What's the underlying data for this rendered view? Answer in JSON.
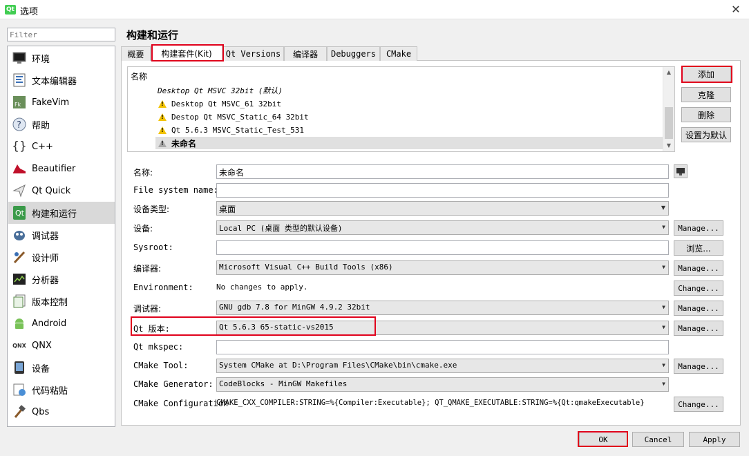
{
  "window": {
    "title": "选项",
    "app_icon_text": "Qt",
    "close_glyph": "✕"
  },
  "sidebar": {
    "filter_placeholder": "Filter",
    "items": [
      {
        "label": "环境",
        "icon": "monitor-icon"
      },
      {
        "label": "文本编辑器",
        "icon": "text-editor-icon"
      },
      {
        "label": "FakeVim",
        "icon": "fakevim-icon"
      },
      {
        "label": "帮助",
        "icon": "help-icon"
      },
      {
        "label": "C++",
        "icon": "cpp-icon"
      },
      {
        "label": "Beautifier",
        "icon": "beautifier-icon"
      },
      {
        "label": "Qt Quick",
        "icon": "qt-quick-icon"
      },
      {
        "label": "构建和运行",
        "icon": "build-run-icon"
      },
      {
        "label": "调试器",
        "icon": "debugger-icon"
      },
      {
        "label": "设计师",
        "icon": "designer-icon"
      },
      {
        "label": "分析器",
        "icon": "analyzer-icon"
      },
      {
        "label": "版本控制",
        "icon": "version-control-icon"
      },
      {
        "label": "Android",
        "icon": "android-icon"
      },
      {
        "label": "QNX",
        "icon": "qnx-icon"
      },
      {
        "label": "设备",
        "icon": "device-icon"
      },
      {
        "label": "代码粘贴",
        "icon": "code-paste-icon"
      },
      {
        "label": "Qbs",
        "icon": "qbs-icon"
      }
    ]
  },
  "main": {
    "title": "构建和运行",
    "tabs": [
      "概要",
      "构建套件(Kit)",
      "Qt Versions",
      "编译器",
      "Debuggers",
      "CMake"
    ],
    "kit_list": {
      "header": "名称",
      "group": "Desktop Qt MSVC 32bit (默认)",
      "rows": [
        "Desktop Qt MSVC_61 32bit",
        "Destop Qt MSVC_Static_64 32bit",
        "Qt 5.6.3 MSVC_Static_Test_531",
        "未命名"
      ]
    },
    "side_buttons": {
      "add": "添加",
      "clone": "克隆",
      "delete": "删除",
      "set_default": "设置为默认"
    },
    "form": {
      "name": {
        "label": "名称:",
        "value": "未命名"
      },
      "file_system_name": {
        "label": "File system name:",
        "value": ""
      },
      "device_type": {
        "label": "设备类型:",
        "value": "桌面"
      },
      "device": {
        "label": "设备:",
        "value": "Local PC (桌面 类型的默认设备)",
        "button": "Manage..."
      },
      "sysroot": {
        "label": "Sysroot:",
        "value": "",
        "button": "浏览..."
      },
      "compiler": {
        "label": "编译器:",
        "value": "Microsoft Visual C++ Build Tools (x86)",
        "button": "Manage..."
      },
      "environment": {
        "label": "Environment:",
        "value": "No changes to apply.",
        "button": "Change..."
      },
      "debugger": {
        "label": "调试器:",
        "value": "GNU gdb 7.8 for MinGW 4.9.2 32bit",
        "button": "Manage..."
      },
      "qt_version": {
        "label": "Qt 版本:",
        "value": "Qt 5.6.3 65-static-vs2015",
        "button": "Manage..."
      },
      "qt_mkspec": {
        "label": "Qt mkspec:",
        "value": ""
      },
      "cmake_tool": {
        "label": "CMake Tool:",
        "value": "System CMake at D:\\Program Files\\CMake\\bin\\cmake.exe",
        "button": "Manage..."
      },
      "cmake_generator": {
        "label": "CMake Generator:",
        "value": "CodeBlocks - MinGW Makefiles"
      },
      "cmake_configuration": {
        "label": "CMake Configuration",
        "value": "CMAKE_CXX_COMPILER:STRING=%{Compiler:Executable}; QT_QMAKE_EXECUTABLE:STRING=%{Qt:qmakeExecutable}",
        "button": "Change..."
      }
    }
  },
  "footer": {
    "ok": "OK",
    "cancel": "Cancel",
    "apply": "Apply"
  },
  "colors": {
    "highlight": "#e0001b",
    "warning": "#f2c200",
    "qt_green": "#41cd52"
  }
}
